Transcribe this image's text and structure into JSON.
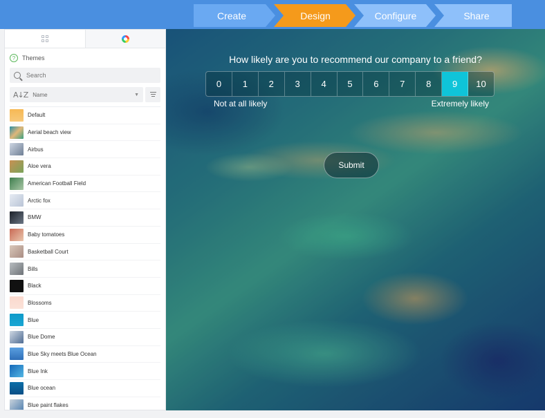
{
  "wizard": {
    "steps": [
      {
        "label": "Create",
        "color": "#6aa9f2"
      },
      {
        "label": "Design",
        "color": "#f59a1b",
        "active": true
      },
      {
        "label": "Configure",
        "color": "#8ec0fa"
      },
      {
        "label": "Share",
        "color": "#8ec0fa"
      }
    ]
  },
  "sidebar": {
    "tabs": [
      {
        "icon": "grid-icon"
      },
      {
        "icon": "color-wheel-icon"
      }
    ],
    "themes_label": "Themes",
    "search_placeholder": "Search",
    "sort_label": "Name",
    "themes": [
      {
        "name": "Default",
        "swatch": "linear-gradient(#f7b955,#f7c97a)"
      },
      {
        "name": "Aerial beach view",
        "swatch": "linear-gradient(135deg,#2b8fa6,#e0b77a,#3aa07f)"
      },
      {
        "name": "Airbus",
        "swatch": "linear-gradient(135deg,#cdd6e2,#6f7f95)"
      },
      {
        "name": "Aloe vera",
        "swatch": "linear-gradient(135deg,#c89053,#7aa35a)"
      },
      {
        "name": "American Football Field",
        "swatch": "linear-gradient(135deg,#3f7f4f,#a9c7a6)"
      },
      {
        "name": "Arctic fox",
        "swatch": "linear-gradient(135deg,#e6ebf3,#b9c4d6)"
      },
      {
        "name": "BMW",
        "swatch": "linear-gradient(135deg,#1b2028,#6b7684)"
      },
      {
        "name": "Baby tomatoes",
        "swatch": "linear-gradient(135deg,#c96a55,#e9c6ad)"
      },
      {
        "name": "Basketball Court",
        "swatch": "linear-gradient(135deg,#d9c7b9,#a98d83)"
      },
      {
        "name": "Bills",
        "swatch": "linear-gradient(135deg,#b8bcc0,#6e7378)"
      },
      {
        "name": "Black",
        "swatch": "linear-gradient(#111,#111)"
      },
      {
        "name": "Blossoms",
        "swatch": "linear-gradient(#fbd9ce,#fbe2d8)"
      },
      {
        "name": "Blue",
        "swatch": "linear-gradient(#0e9ac9,#1aa6d3)"
      },
      {
        "name": "Blue Dome",
        "swatch": "linear-gradient(135deg,#cfd8e3,#4f6c93)"
      },
      {
        "name": "Blue Sky meets Blue Ocean",
        "swatch": "linear-gradient(#5a9fe0,#2f6fb8)"
      },
      {
        "name": "Blue Ink",
        "swatch": "linear-gradient(135deg,#1467b8,#53b6e3)"
      },
      {
        "name": "Blue ocean",
        "swatch": "linear-gradient(#0d6fa8,#0a4e85)"
      },
      {
        "name": "Blue paint flakes",
        "swatch": "linear-gradient(135deg,#c9d3dc,#4f7fae)"
      }
    ]
  },
  "survey": {
    "question": "How likely are you to recommend our company to a friend?",
    "scale": [
      "0",
      "1",
      "2",
      "3",
      "4",
      "5",
      "6",
      "7",
      "8",
      "9",
      "10"
    ],
    "selected": "9",
    "low_label": "Not at all likely",
    "high_label": "Extremely likely",
    "submit_label": "Submit",
    "accent_color": "#0fc4d9"
  }
}
